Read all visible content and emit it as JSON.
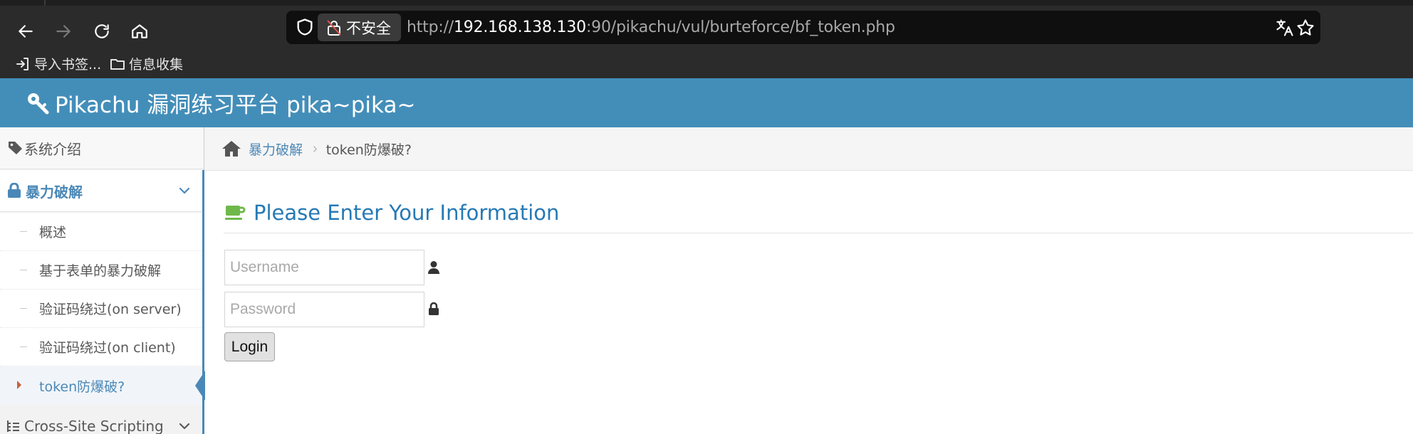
{
  "browser": {
    "security_label": "不安全",
    "url_prefix": "http://",
    "url_host": "192.168.138.130",
    "url_rest": ":90/pikachu/vul/burteforce/bf_token.php",
    "bookmarks": [
      {
        "label": "导入书签..."
      },
      {
        "label": "信息收集"
      }
    ]
  },
  "header": {
    "brand": "Pikachu 漏洞练习平台 pika~pika~"
  },
  "sidebar": {
    "intro": "系统介绍",
    "category": "暴力破解",
    "items": [
      {
        "label": "概述"
      },
      {
        "label": "基于表单的暴力破解"
      },
      {
        "label": "验证码绕过(on server)"
      },
      {
        "label": "验证码绕过(on client)"
      },
      {
        "label": "token防爆破?"
      }
    ],
    "next_category": "Cross-Site Scripting"
  },
  "breadcrumbs": {
    "parent": "暴力破解",
    "current": "token防爆破?"
  },
  "form": {
    "title": "Please Enter Your Information",
    "username_placeholder": "Username",
    "username_value": "",
    "password_placeholder": "Password",
    "password_value": "",
    "login_label": "Login"
  },
  "colors": {
    "header": "#438eb9",
    "accent": "#4b88b7",
    "title": "#2679b5",
    "coffee_icon": "#6fb84a",
    "active_caret": "#c86139"
  }
}
